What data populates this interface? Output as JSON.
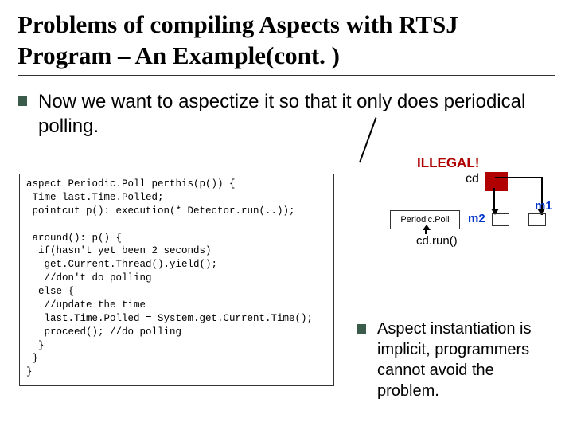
{
  "title": "Problems of compiling Aspects with RTSJ Program – An Example(cont. )",
  "bullet_main": "Now we want to aspectize it so that it only does periodical polling.",
  "illegal_label": "ILLEGAL!",
  "code": "aspect Periodic.Poll perthis(p()) {\n Time last.Time.Polled;\n pointcut p(): execution(* Detector.run(..));\n\n around(): p() {\n  if(hasn't yet been 2 seconds)\n   get.Current.Thread().yield();\n   //don't do polling\n  else {\n   //update the time\n   last.Time.Polled = System.get.Current.Time();\n   proceed(); //do polling\n  }\n }\n}",
  "diagram": {
    "cd": "cd",
    "periodic_poll": "Periodic.Poll",
    "m2": "m2",
    "m1": "m1",
    "cd_run": "cd.run()"
  },
  "note": "Aspect instantiation is implicit, programmers cannot avoid the problem."
}
